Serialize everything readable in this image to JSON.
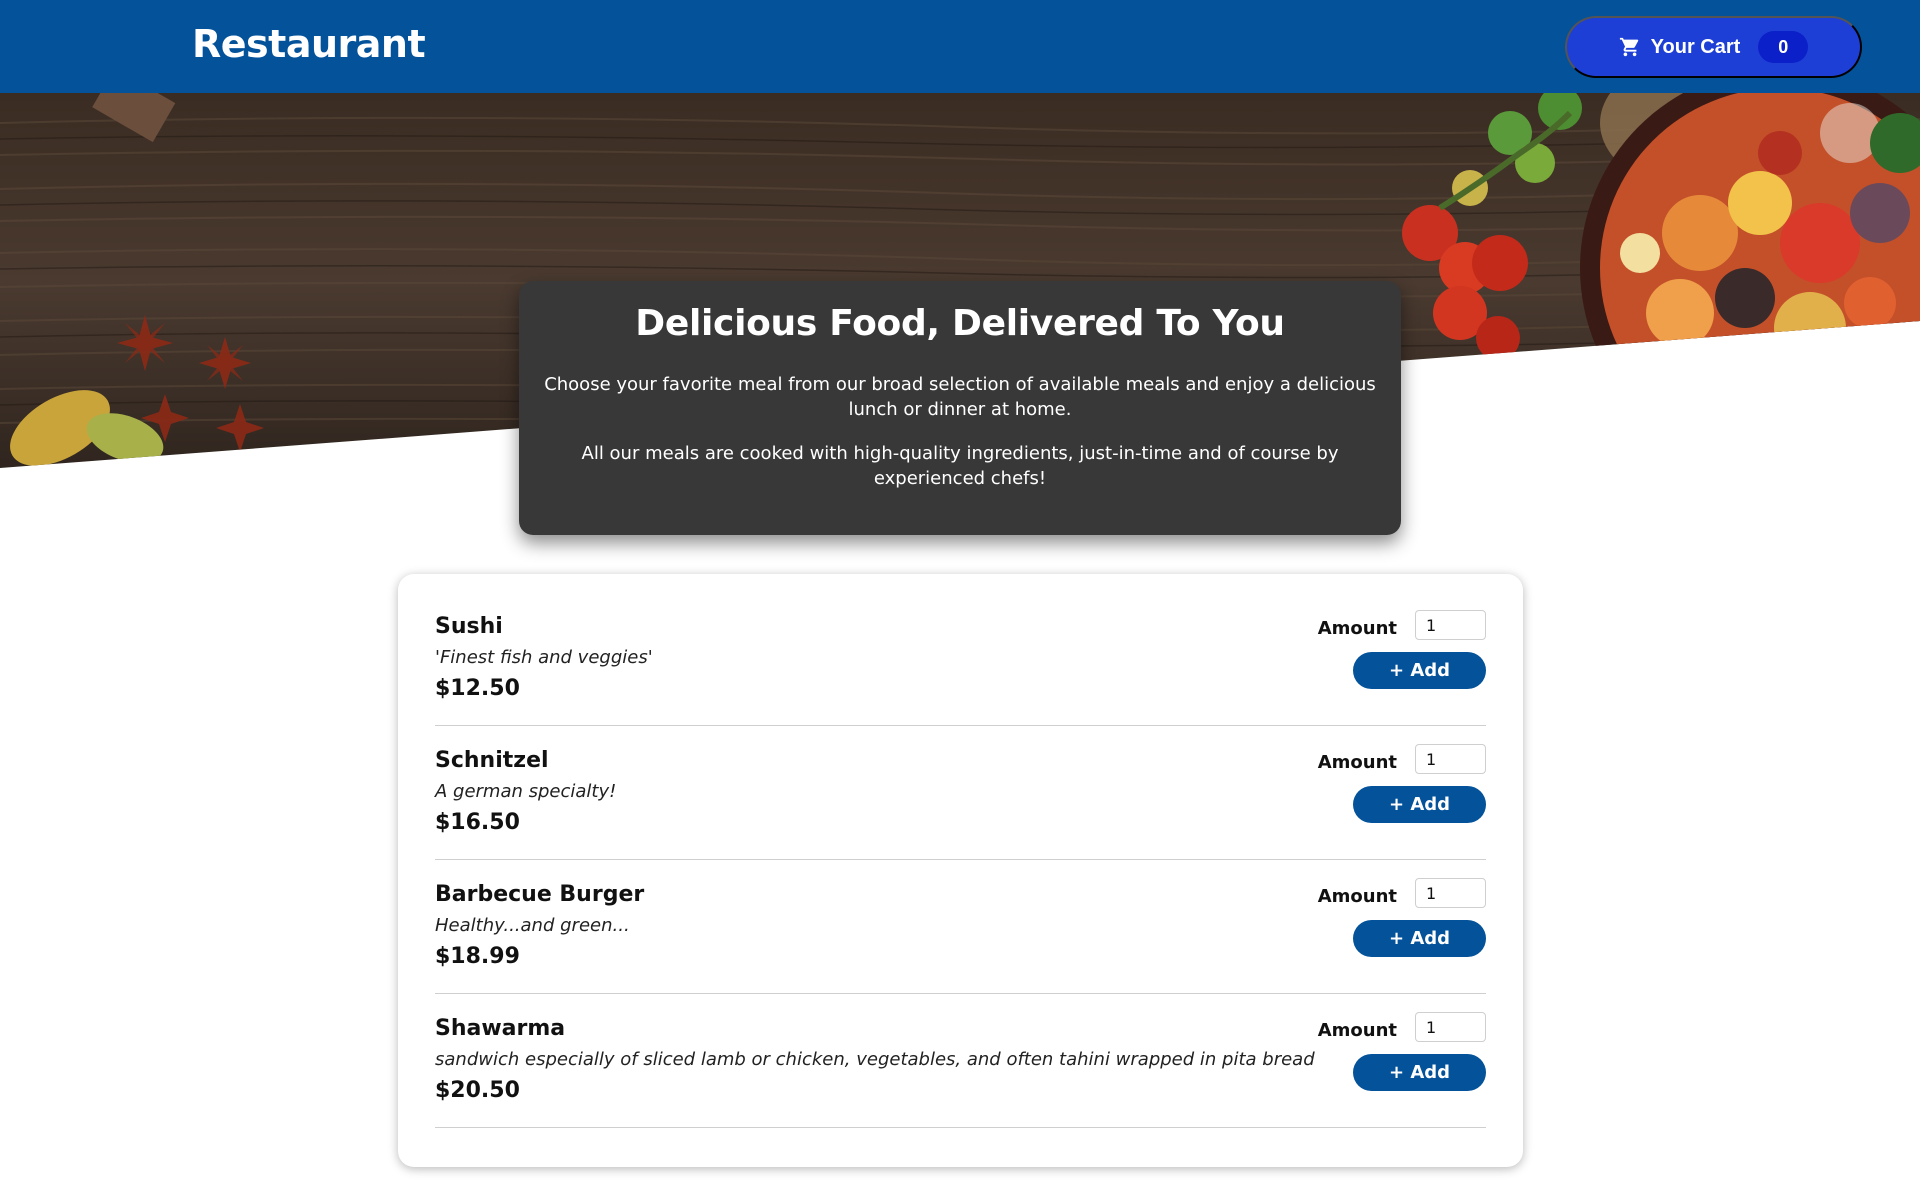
{
  "header": {
    "title": "Restaurant",
    "cart_label": "Your Cart",
    "cart_count": "0",
    "cart_icon": "shopping-cart-icon"
  },
  "summary": {
    "title": "Delicious Food, Delivered To You",
    "paragraph_1": "Choose your favorite meal from our broad selection of available meals and enjoy a delicious lunch or dinner at home.",
    "paragraph_2": "All our meals are cooked with high-quality ingredients, just-in-time and of course by experienced chefs!"
  },
  "meals": {
    "amount_label": "Amount",
    "add_label": "+ Add",
    "items": [
      {
        "name": "Sushi",
        "description": "'Finest fish and veggies'",
        "price": "$12.50",
        "amount": "1"
      },
      {
        "name": "Schnitzel",
        "description": "A german specialty!",
        "price": "$16.50",
        "amount": "1"
      },
      {
        "name": "Barbecue Burger",
        "description": "Healthy...and green...",
        "price": "$18.99",
        "amount": "1"
      },
      {
        "name": "Shawarma",
        "description": "sandwich especially of sliced lamb or chicken, vegetables, and often tahini wrapped in pita bread",
        "price": "$20.50",
        "amount": "1"
      }
    ]
  },
  "colors": {
    "header_bg": "#03529a",
    "cart_button_bg": "#1d3fd6",
    "summary_bg": "#383838",
    "add_button_bg": "#03529a"
  }
}
